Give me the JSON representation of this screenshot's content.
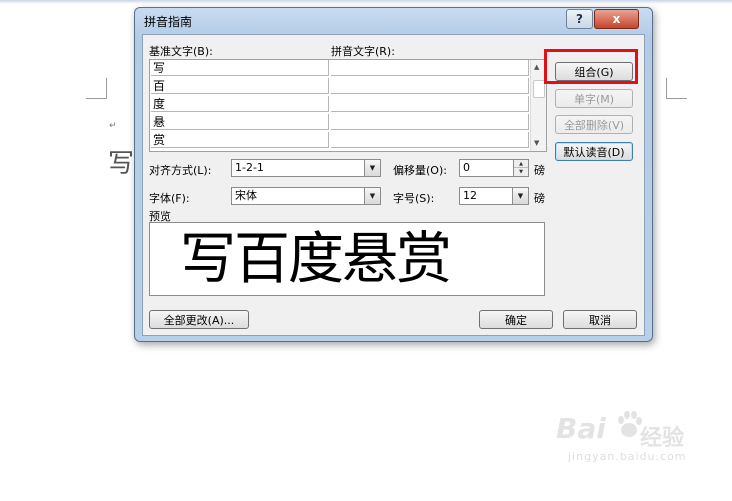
{
  "document": {
    "paragraph_mark": "↵",
    "text_fragment": "写"
  },
  "dialog": {
    "title": "拼音指南",
    "help_label": "?",
    "close_label": "x",
    "labels": {
      "base_text": "基准文字(B):",
      "ruby_text": "拼音文字(R):",
      "alignment": "对齐方式(L):",
      "offset": "偏移量(O):",
      "font": "字体(F):",
      "size": "字号(S):",
      "preview": "预览",
      "offset_unit": "磅",
      "size_unit": "磅"
    },
    "rows": [
      {
        "base": "写",
        "ruby": ""
      },
      {
        "base": "百",
        "ruby": ""
      },
      {
        "base": "度",
        "ruby": ""
      },
      {
        "base": "悬",
        "ruby": ""
      },
      {
        "base": "赏",
        "ruby": ""
      }
    ],
    "buttons": {
      "group": "组合(G)",
      "single": "单字(M)",
      "clear_all": "全部删除(V)",
      "default_reading": "默认读音(D)",
      "change_all": "全部更改(A)...",
      "ok": "确定",
      "cancel": "取消"
    },
    "alignment_value": "1-2-1",
    "offset_value": "0",
    "font_value": "宋体",
    "size_value": "12",
    "preview_text": "写百度悬赏",
    "highlight_color": "#e0101a"
  },
  "watermark": {
    "logo_text": "Bai",
    "product_text": "经验",
    "url": "jingyan.baidu.com"
  }
}
